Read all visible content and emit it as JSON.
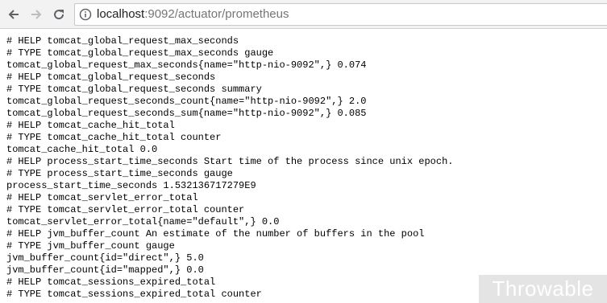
{
  "browser": {
    "url_host": "localhost",
    "url_path": ":9092/actuator/prometheus",
    "icons": {
      "back": "back-arrow-icon",
      "forward": "forward-arrow-icon",
      "reload": "reload-icon",
      "info": "info-icon"
    }
  },
  "content": {
    "lines": [
      "# HELP tomcat_global_request_max_seconds",
      "# TYPE tomcat_global_request_max_seconds gauge",
      "tomcat_global_request_max_seconds{name=\"http-nio-9092\",} 0.074",
      "# HELP tomcat_global_request_seconds",
      "# TYPE tomcat_global_request_seconds summary",
      "tomcat_global_request_seconds_count{name=\"http-nio-9092\",} 2.0",
      "tomcat_global_request_seconds_sum{name=\"http-nio-9092\",} 0.085",
      "# HELP tomcat_cache_hit_total",
      "# TYPE tomcat_cache_hit_total counter",
      "tomcat_cache_hit_total 0.0",
      "# HELP process_start_time_seconds Start time of the process since unix epoch.",
      "# TYPE process_start_time_seconds gauge",
      "process_start_time_seconds 1.532136717279E9",
      "# HELP tomcat_servlet_error_total",
      "# TYPE tomcat_servlet_error_total counter",
      "tomcat_servlet_error_total{name=\"default\",} 0.0",
      "# HELP jvm_buffer_count An estimate of the number of buffers in the pool",
      "# TYPE jvm_buffer_count gauge",
      "jvm_buffer_count{id=\"direct\",} 5.0",
      "jvm_buffer_count{id=\"mapped\",} 0.0",
      "# HELP tomcat_sessions_expired_total",
      "# TYPE tomcat_sessions_expired_total counter"
    ]
  },
  "watermark": {
    "text": "Throwable"
  }
}
